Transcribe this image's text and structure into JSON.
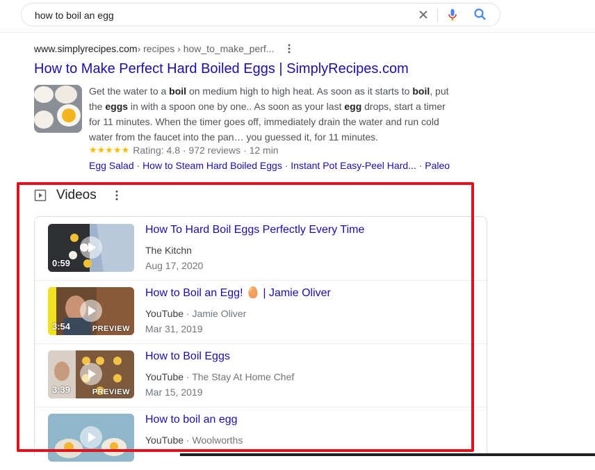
{
  "search": {
    "query": "how to boil an egg"
  },
  "result": {
    "cite_domain": "www.simplyrecipes.com",
    "cite_path": " › recipes › how_to_make_perf...",
    "title": "How to Make Perfect Hard Boiled Eggs | SimplyRecipes.com",
    "snippet_parts": [
      "Get the water to a ",
      "boil",
      " on medium high to high heat. As soon as it starts to ",
      "boil",
      ", put the ",
      "eggs",
      " in with a spoon one by one.. As soon as your last ",
      "egg",
      " drops, start a timer for 11 minutes. When the timer goes off, immediately drain the water and run cold water from the faucet into the pan… you guessed it, for 11 minutes."
    ],
    "stars": "★★★★★",
    "rating_text": "Rating: 4.8 · 972 reviews · 12 min",
    "sitelinks": [
      "Egg Salad",
      "How to Steam Hard Boiled Eggs",
      "Instant Pot Easy-Peel Hard...",
      "Paleo"
    ],
    "sitelink_sep": " · "
  },
  "videos": {
    "heading": "Videos",
    "items": [
      {
        "title": "How To Hard Boil Eggs Perfectly Every Time",
        "source": "The Kitchn",
        "channel": "",
        "date": "Aug 17, 2020",
        "duration": "0:59",
        "preview": ""
      },
      {
        "title": "How to Boil an Egg! 🥚 | Jamie Oliver",
        "source": "YouTube",
        "channel": " · Jamie Oliver",
        "date": "Mar 31, 2019",
        "duration": "3:54",
        "preview": "PREVIEW"
      },
      {
        "title": "How to Boil Eggs",
        "source": "YouTube",
        "channel": " · The Stay At Home Chef",
        "date": "Mar 15, 2019",
        "duration": "3:39",
        "preview": "PREVIEW"
      },
      {
        "title": "How to boil an egg",
        "source": "YouTube",
        "channel": " · Woolworths",
        "date": "",
        "duration": "",
        "preview": ""
      }
    ]
  },
  "colors": {
    "link": "#1a0dab",
    "highlight": "#e1131a",
    "star": "#fbbc04"
  }
}
